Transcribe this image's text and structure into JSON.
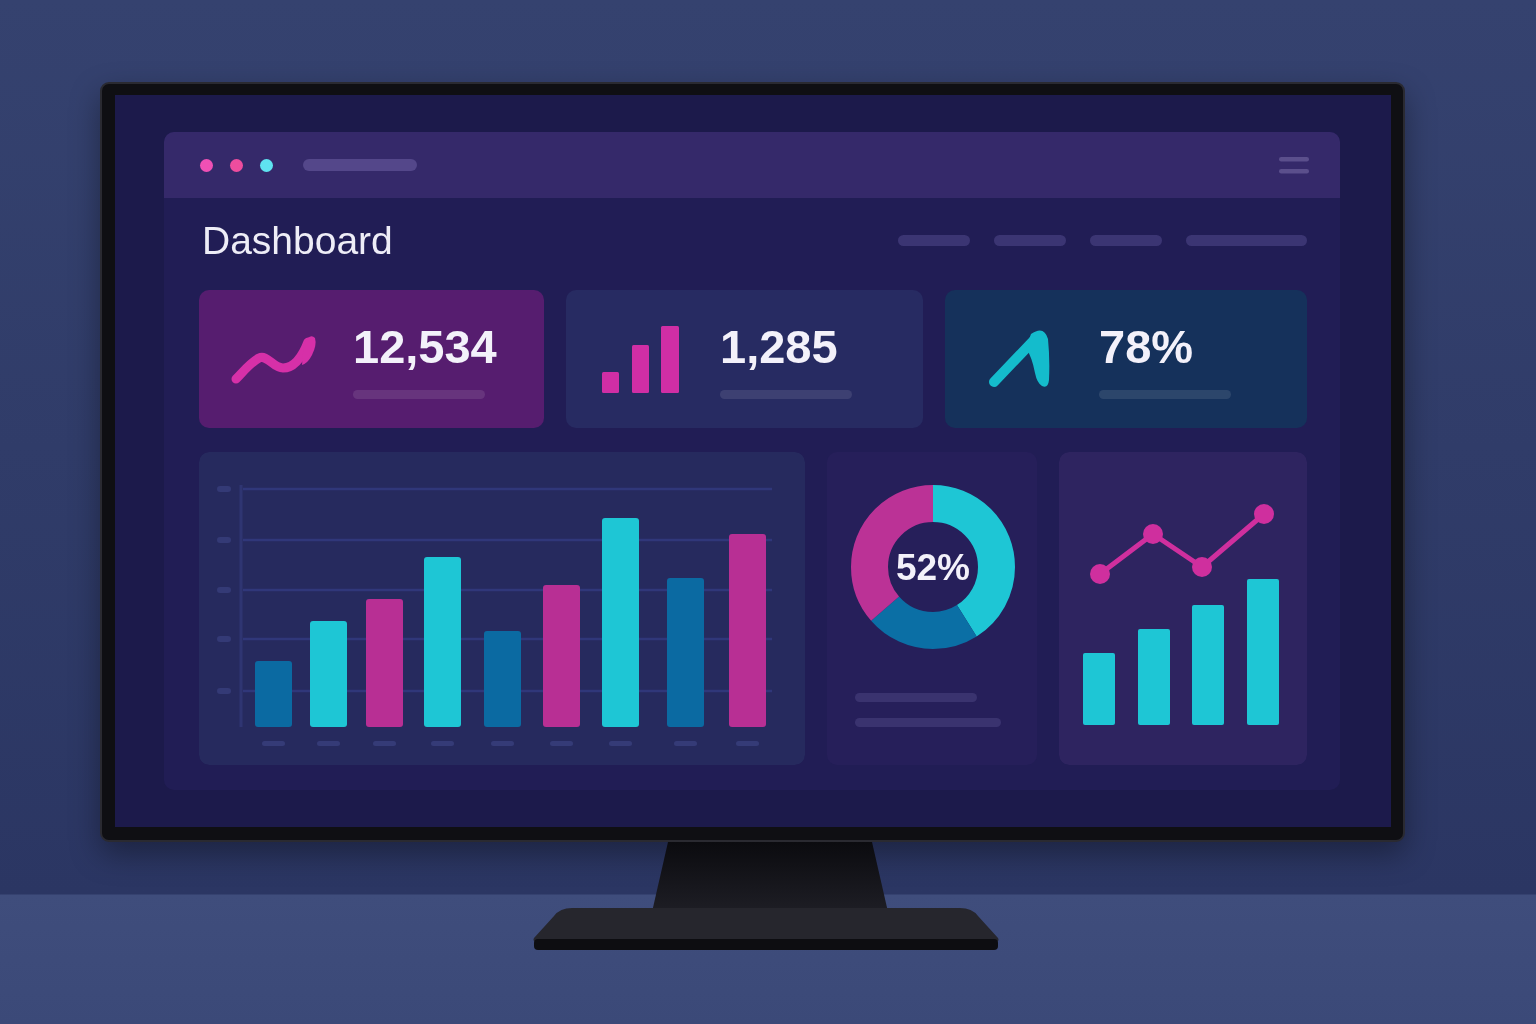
{
  "window": {
    "controls": [
      {
        "color": "#f050b5"
      },
      {
        "color": "#ee4d9e"
      },
      {
        "color": "#5fe3f0"
      }
    ]
  },
  "page": {
    "title": "Dashboard"
  },
  "stats": [
    {
      "kind": "trend",
      "value": "12,534"
    },
    {
      "kind": "bars",
      "value": "1,285"
    },
    {
      "kind": "peak",
      "value": "78%"
    }
  ],
  "donut_card": {
    "value": "52%"
  }
}
